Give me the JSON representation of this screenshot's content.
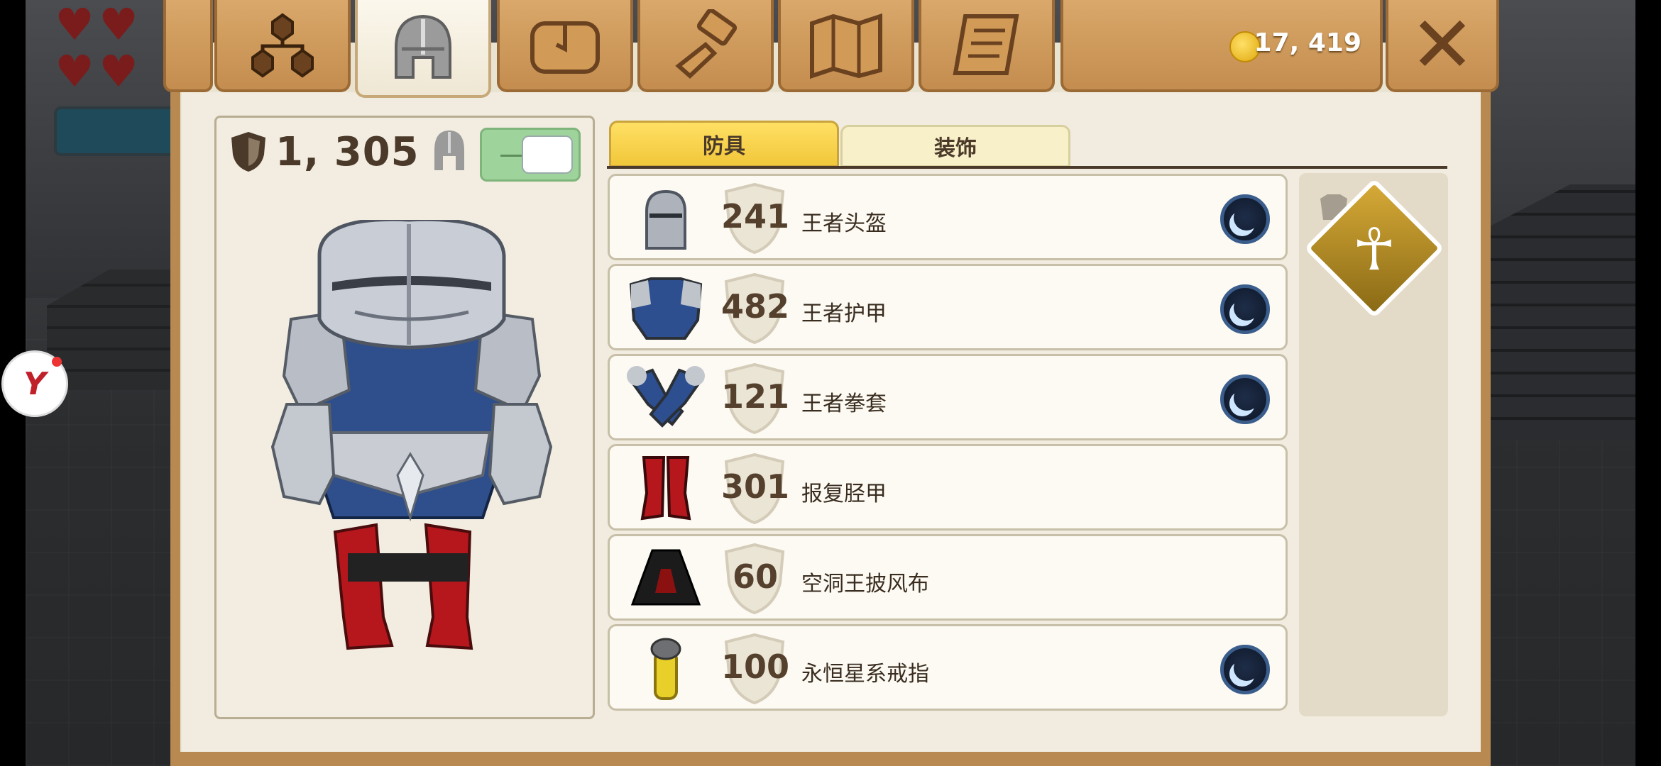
{
  "colors": {
    "panel": "#e9e3d2",
    "wood_tab": "#c48d4f",
    "active_subtab": "#f1c73a",
    "text_dark": "#4b3a2a",
    "toggle_green": "#9fd39c",
    "relic_gold": "#d6a937"
  },
  "hud": {
    "hearts": [
      "heart-icon",
      "heart-icon",
      "heart-icon",
      "heart-icon"
    ],
    "side_badge_text": "Y"
  },
  "tabs": [
    {
      "icon": "skill-tree-icon",
      "active": false
    },
    {
      "icon": "helmet-icon",
      "active": true
    },
    {
      "icon": "bag-icon",
      "active": false
    },
    {
      "icon": "crafting-hammer-icon",
      "active": false
    },
    {
      "icon": "map-icon",
      "active": false
    },
    {
      "icon": "quest-scroll-icon",
      "active": false
    }
  ],
  "currency": {
    "icon": "gold-coin-icon",
    "value": "17, 419"
  },
  "close_icon": "close-icon",
  "character": {
    "armor_total": "1, 305",
    "armor_icon": "shield-icon",
    "helmet_toggle_icon": "helmet-icon",
    "helmet_toggle_on": true
  },
  "subtabs": {
    "armor": "防具",
    "accessories": "装饰"
  },
  "items": [
    {
      "name": "王者头盔",
      "power": "241",
      "icon": "helmet-item-icon",
      "equipped_badge": true
    },
    {
      "name": "王者护甲",
      "power": "482",
      "icon": "chestplate-item-icon",
      "equipped_badge": true
    },
    {
      "name": "王者拳套",
      "power": "121",
      "icon": "gauntlets-item-icon",
      "equipped_badge": true
    },
    {
      "name": "报复胫甲",
      "power": "301",
      "icon": "greaves-item-icon",
      "equipped_badge": false
    },
    {
      "name": "空洞王披风布",
      "power": "60",
      "icon": "cape-item-icon",
      "equipped_badge": false
    },
    {
      "name": "永恒星系戒指",
      "power": "100",
      "icon": "ring-item-icon",
      "equipped_badge": true
    }
  ],
  "relic": {
    "glyph": "☥",
    "icon": "ankh-relic-icon"
  }
}
